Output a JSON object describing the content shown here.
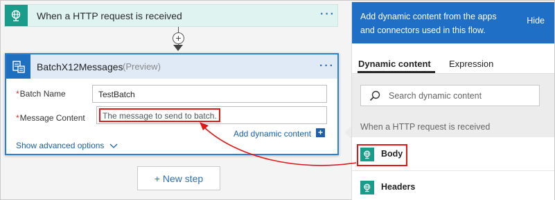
{
  "trigger": {
    "title": "When a HTTP request is received",
    "more_label": "···"
  },
  "connector": {
    "plus_label": "+"
  },
  "action": {
    "title": "BatchX12Messages",
    "preview": "(Preview)",
    "more_label": "···",
    "fields": {
      "batch_name": {
        "label": "Batch Name",
        "value": "TestBatch"
      },
      "message_content": {
        "label": "Message Content",
        "value": "The message to send to batch."
      }
    },
    "required_mark": "*",
    "add_dynamic_label": "Add dynamic content",
    "add_dynamic_plus": "+",
    "show_advanced_label": "Show advanced options"
  },
  "new_step_label": "+ New step",
  "panel": {
    "header_text": "Add dynamic content from the apps and connectors used in this flow.",
    "hide_label": "Hide",
    "tabs": [
      {
        "label": "Dynamic content",
        "active": true
      },
      {
        "label": "Expression",
        "active": false
      }
    ],
    "search": {
      "placeholder": "Search dynamic content"
    },
    "section_title": "When a HTTP request is received",
    "items": [
      {
        "label": "Body"
      },
      {
        "label": "Headers"
      }
    ]
  },
  "colors": {
    "accent_blue": "#1f6fc6",
    "trigger_teal": "#1a9c8b",
    "highlight_red": "#e01818",
    "link_blue": "#1a5fa8"
  }
}
